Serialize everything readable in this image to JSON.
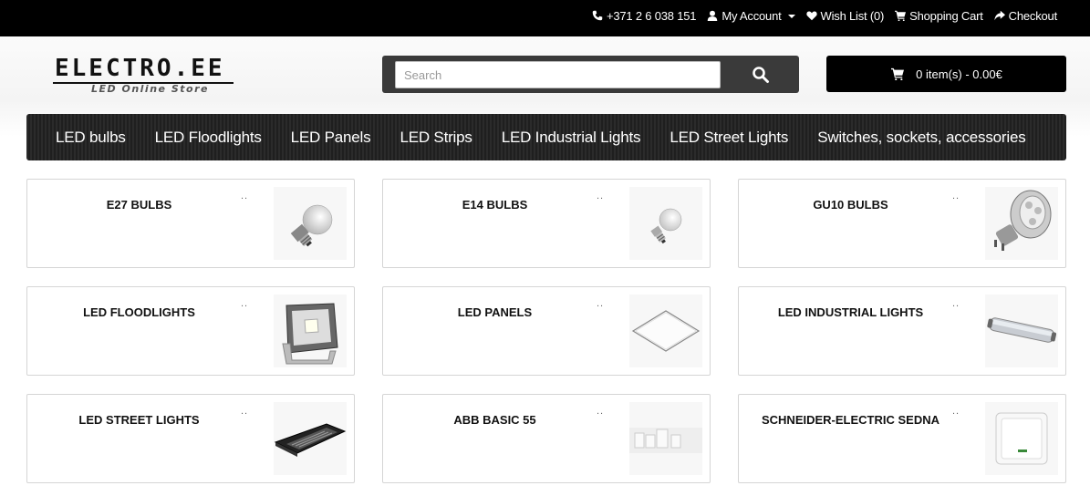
{
  "topbar": {
    "phone": "+371 2 6 038 151",
    "my_account": "My Account",
    "wish_list": "Wish List (0)",
    "shopping_cart": "Shopping Cart",
    "checkout": "Checkout"
  },
  "header": {
    "logo_text": "ELECTRO.EE",
    "logo_subtitle": "LED Online Store",
    "search_placeholder": "Search",
    "cart_summary": "0 item(s) - 0.00€"
  },
  "nav": {
    "items": [
      {
        "label": "LED bulbs"
      },
      {
        "label": "LED Floodlights"
      },
      {
        "label": "LED Panels"
      },
      {
        "label": "LED Strips"
      },
      {
        "label": "LED Industrial Lights"
      },
      {
        "label": "LED Street Lights"
      },
      {
        "label": "Switches, sockets, accessories"
      }
    ]
  },
  "categories": [
    {
      "title": "E27 BULBS",
      "dots": "..",
      "image": "e27-bulb"
    },
    {
      "title": "E14 BULBS",
      "dots": "..",
      "image": "e14-bulb"
    },
    {
      "title": "GU10 BULBS",
      "dots": "..",
      "image": "gu10-bulb"
    },
    {
      "title": "LED FLOODLIGHTS",
      "dots": "..",
      "image": "floodlight"
    },
    {
      "title": "LED PANELS",
      "dots": "..",
      "image": "led-panel"
    },
    {
      "title": "LED INDUSTRIAL LIGHTS",
      "dots": "..",
      "image": "industrial-light"
    },
    {
      "title": "LED STREET LIGHTS",
      "dots": "..",
      "image": "street-light"
    },
    {
      "title": "ABB BASIC 55",
      "dots": "..",
      "image": "abb-switches"
    },
    {
      "title": "SCHNEIDER-ELECTRIC SEDNA",
      "dots": "..",
      "image": "schneider-switch"
    }
  ],
  "colors": {
    "topbar_bg": "#000000",
    "nav_bg": "#222222",
    "search_bg": "#3a3a3a",
    "cart_bg": "#000000"
  }
}
